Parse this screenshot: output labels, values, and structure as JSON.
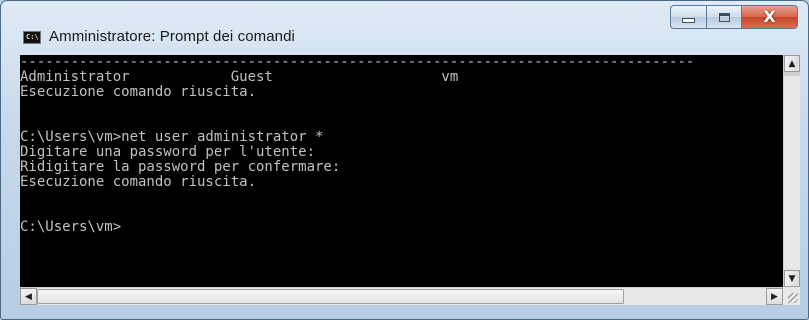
{
  "window": {
    "title": "Amministratore: Prompt dei comandi",
    "app_icon_glyph": "C:\\"
  },
  "caption_buttons": {
    "minimize_icon": "minimize-icon",
    "maximize_icon": "maximize-icon",
    "close_icon": "close-icon",
    "close_glyph": "X"
  },
  "console": {
    "lines": [
      "--------------------------------------------------------------------------------",
      "Administrator            Guest                    vm",
      "Esecuzione comando riuscita.",
      "",
      "",
      "C:\\Users\\vm>net user administrator *",
      "Digitare una password per l'utente:",
      "Ridigitare la password per confermare:",
      "Esecuzione comando riuscita.",
      "",
      "",
      "C:\\Users\\vm>"
    ]
  },
  "scrollbars": {
    "up_arrow": "▲",
    "down_arrow": "▼",
    "left_arrow": "◀",
    "right_arrow": "▶"
  },
  "colors": {
    "console_bg": "#000000",
    "console_text": "#c0c0c0",
    "close_button": "#c4452a"
  }
}
